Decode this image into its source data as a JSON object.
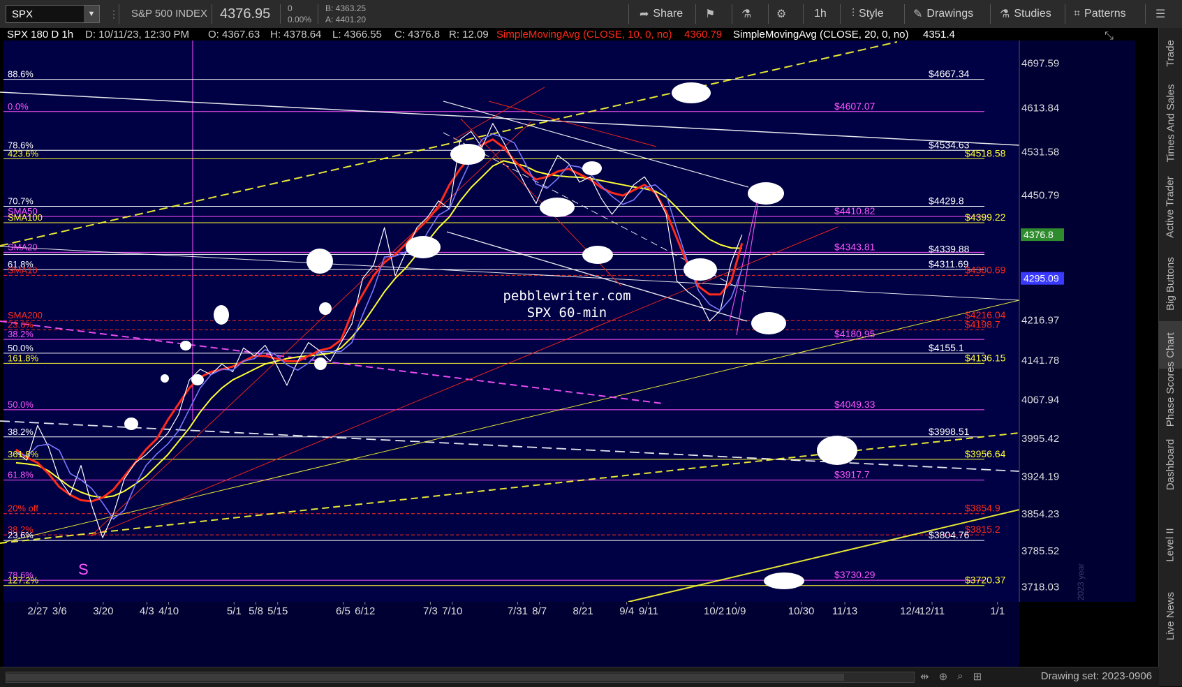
{
  "toolbar": {
    "symbol": "SPX",
    "name": "S&P 500 INDEX",
    "price": "4376.95",
    "change": "0",
    "change_pct": "0.00%",
    "bid": "B: 4363.25",
    "ask": "A: 4401.20",
    "share": "Share",
    "timeframe": "1h",
    "style": "Style",
    "drawings": "Drawings",
    "studies": "Studies",
    "patterns": "Patterns",
    "icons": [
      "share-icon",
      "flag-icon",
      "flask-icon",
      "gear-icon",
      "style-icon",
      "pencil-icon",
      "studies-icon",
      "patterns-icon",
      "menu-icon"
    ]
  },
  "header": {
    "period": "SPX 180 D 1h",
    "date": "D: 10/11/23, 12:30 PM",
    "open": "O: 4367.63",
    "high": "H: 4378.64",
    "low": "L: 4366.55",
    "close": "C: 4376.8",
    "range": "R: 12.09",
    "sma10": "SimpleMovingAvg (CLOSE, 10, 0, no)",
    "sma10_val": "4360.79",
    "sma20": "SimpleMovingAvg (CLOSE, 20, 0, no)",
    "sma20_val": "4351.4"
  },
  "watermark": {
    "line1": "pebblewriter.com",
    "line2": "SPX 60-min"
  },
  "footer": {
    "drawing_set": "Drawing set: 2023-0906"
  },
  "sidetabs": [
    "Trade",
    "Times And Sales",
    "Active Trader",
    "Big Buttons",
    "Chart",
    "Phase Scores",
    "Dashboard",
    "Level II",
    "Live News"
  ],
  "colors": {
    "background": "#000044",
    "white": "#ffffff",
    "yellow": "#ffff33",
    "magenta": "#ff55ff",
    "red": "#ff2a1a",
    "blue": "#7878ff",
    "price_badge": "#2e8b2e",
    "sma_badge": "#3a3aff"
  },
  "chart_data": {
    "type": "line",
    "title": "SPX 180 D 1h",
    "ylim": [
      3690,
      4740
    ],
    "y_ticks": [
      "4697.59",
      "4613.84",
      "4531.58",
      "4450.79",
      "4376.8",
      "4295.09",
      "4216.97",
      "4141.78",
      "4067.94",
      "3995.42",
      "3924.19",
      "3854.23",
      "3785.52",
      "3718.03"
    ],
    "x_ticks": [
      "2/27",
      "3/6",
      "3/20",
      "4/3",
      "4/10",
      "5/1",
      "5/8",
      "5/15",
      "6/5",
      "6/12",
      "7/3",
      "7/10",
      "7/31",
      "8/7",
      "8/21",
      "9/4",
      "9/11",
      "10/2",
      "10/9",
      "10/30",
      "11/13",
      "12/4",
      "12/11",
      "1/1"
    ],
    "x_dates": [
      "2023-02-27",
      "2023-03-06",
      "2023-03-20",
      "2023-04-03",
      "2023-04-10",
      "2023-05-01",
      "2023-05-08",
      "2023-05-15",
      "2023-06-05",
      "2023-06-12",
      "2023-07-03",
      "2023-07-10",
      "2023-07-31",
      "2023-08-07",
      "2023-08-21",
      "2023-09-04",
      "2023-09-11",
      "2023-10-02",
      "2023-10-09",
      "2023-10-30",
      "2023-11-13",
      "2023-12-04",
      "2023-12-11",
      "2024-01-01"
    ],
    "price_badges": [
      "4376.8",
      "4295.09"
    ],
    "series": [
      {
        "name": "SPX",
        "values": [
          3970,
          3955,
          4020,
          3980,
          3920,
          3890,
          3945,
          3870,
          3810,
          3855,
          3920,
          3950,
          3965,
          3985,
          4005,
          4040,
          4105,
          4125,
          4115,
          4135,
          4120,
          4165,
          4150,
          4170,
          4135,
          4095,
          4140,
          4175,
          4160,
          4140,
          4175,
          4210,
          4295,
          4320,
          4390,
          4300,
          4345,
          4390,
          4410,
          4440,
          4425,
          4555,
          4570,
          4540,
          4585,
          4550,
          4510,
          4470,
          4435,
          4485,
          4525,
          4510,
          4475,
          4485,
          4445,
          4415,
          4440,
          4470,
          4485,
          4455,
          4415,
          4290,
          4270,
          4255,
          4215,
          4235,
          4325,
          4376.8
        ]
      },
      {
        "name": "SimpleMovingAvg (CLOSE, 10, 0, no)",
        "values": [
          3975,
          3960,
          3950,
          3930,
          3905,
          3890,
          3880,
          3878,
          3885,
          3900,
          3925,
          3950,
          3975,
          3995,
          4030,
          4060,
          4090,
          4110,
          4120,
          4125,
          4130,
          4140,
          4150,
          4150,
          4145,
          4140,
          4140,
          4150,
          4160,
          4165,
          4180,
          4230,
          4265,
          4300,
          4325,
          4340,
          4360,
          4385,
          4405,
          4430,
          4470,
          4500,
          4525,
          4545,
          4555,
          4540,
          4515,
          4495,
          4480,
          4485,
          4495,
          4500,
          4490,
          4480,
          4465,
          4455,
          4450,
          4460,
          4470,
          4455,
          4420,
          4370,
          4320,
          4280,
          4265,
          4265,
          4290,
          4360.79
        ]
      },
      {
        "name": "SimpleMovingAvg (CLOSE, 20, 0, no)",
        "values": [
          3950,
          3948,
          3945,
          3935,
          3920,
          3905,
          3895,
          3888,
          3885,
          3888,
          3897,
          3910,
          3925,
          3945,
          3965,
          3990,
          4015,
          4045,
          4070,
          4090,
          4105,
          4115,
          4125,
          4135,
          4140,
          4145,
          4148,
          4150,
          4152,
          4155,
          4165,
          4185,
          4210,
          4240,
          4270,
          4295,
          4315,
          4340,
          4365,
          4390,
          4410,
          4440,
          4465,
          4485,
          4505,
          4515,
          4510,
          4505,
          4495,
          4490,
          4487,
          4485,
          4484,
          4482,
          4478,
          4474,
          4470,
          4466,
          4463,
          4458,
          4447,
          4427,
          4405,
          4385,
          4368,
          4358,
          4352,
          4351.4
        ]
      }
    ],
    "levels": [
      {
        "value": 4667.34,
        "left_label": "88.6%",
        "right_label": "$4667.34",
        "color": "#ffffff"
      },
      {
        "value": 4607.07,
        "left_label": "0.0%",
        "right_label": "$4607.07",
        "color": "#ff55ff"
      },
      {
        "value": 4534.63,
        "left_label": "78.6%",
        "right_label": "$4534.63",
        "color": "#ffffff"
      },
      {
        "value": 4518.58,
        "left_label": "423.6%",
        "right_label": "$4518.58",
        "color": "#ffff33"
      },
      {
        "value": 4429.8,
        "left_label": "70.7%",
        "right_label": "$4429.8",
        "color": "#ffffff"
      },
      {
        "value": 4410.82,
        "left_label": "SMA50",
        "right_label": "$4410.82",
        "color": "#ff55ff"
      },
      {
        "value": 4399.22,
        "left_label": "SMA100",
        "right_label": "$4399.22",
        "color": "#ffff33"
      },
      {
        "value": 4343.81,
        "left_label": "SMA20",
        "right_label": "$4343.81",
        "color": "#ff55ff"
      },
      {
        "value": 4339.88,
        "left_label": "",
        "right_label": "$4339.88",
        "color": "#ffffff"
      },
      {
        "value": 4311.69,
        "left_label": "61.8%",
        "right_label": "$4311.69",
        "color": "#ffffff"
      },
      {
        "value": 4300.69,
        "left_label": "SMA10",
        "right_label": "$4300.69",
        "color": "#ff2a1a"
      },
      {
        "value": 4216.04,
        "left_label": "SMA200",
        "right_label": "$4216.04",
        "color": "#ff2a1a"
      },
      {
        "value": 4198.7,
        "left_label": "23.6%",
        "right_label": "$4198.7",
        "color": "#ff2a1a"
      },
      {
        "value": 4180.95,
        "left_label": "38.2%",
        "right_label": "$4180.95",
        "color": "#ff55ff"
      },
      {
        "value": 4155.1,
        "left_label": "50.0%",
        "right_label": "$4155.1",
        "color": "#ffffff"
      },
      {
        "value": 4136.15,
        "left_label": "161.8%",
        "right_label": "$4136.15",
        "color": "#ffff33"
      },
      {
        "value": 4049.33,
        "left_label": "50.0%",
        "right_label": "$4049.33",
        "color": "#ff55ff"
      },
      {
        "value": 3998.51,
        "left_label": "38.2%",
        "right_label": "$3998.51",
        "color": "#ffffff"
      },
      {
        "value": 3956.64,
        "left_label": "361.8%",
        "right_label": "$3956.64",
        "color": "#ffff33"
      },
      {
        "value": 3917.7,
        "left_label": "61.8%",
        "right_label": "$3917.7",
        "color": "#ff55ff"
      },
      {
        "value": 3854.9,
        "left_label": "20% off",
        "right_label": "$3854.9",
        "color": "#ff2a1a"
      },
      {
        "value": 3815.2,
        "left_label": "38.2%",
        "right_label": "$3815.2",
        "color": "#ff2a1a"
      },
      {
        "value": 3804.76,
        "left_label": "23.6%",
        "right_label": "$3804.76",
        "color": "#ffffff"
      },
      {
        "value": 3730.29,
        "left_label": "78.6%",
        "right_label": "$3730.29",
        "color": "#ff55ff"
      },
      {
        "value": 3720.37,
        "left_label": "127.2%",
        "right_label": "$3720.37",
        "color": "#ffff33"
      }
    ],
    "annotations": [
      "S",
      "2023 year"
    ]
  }
}
